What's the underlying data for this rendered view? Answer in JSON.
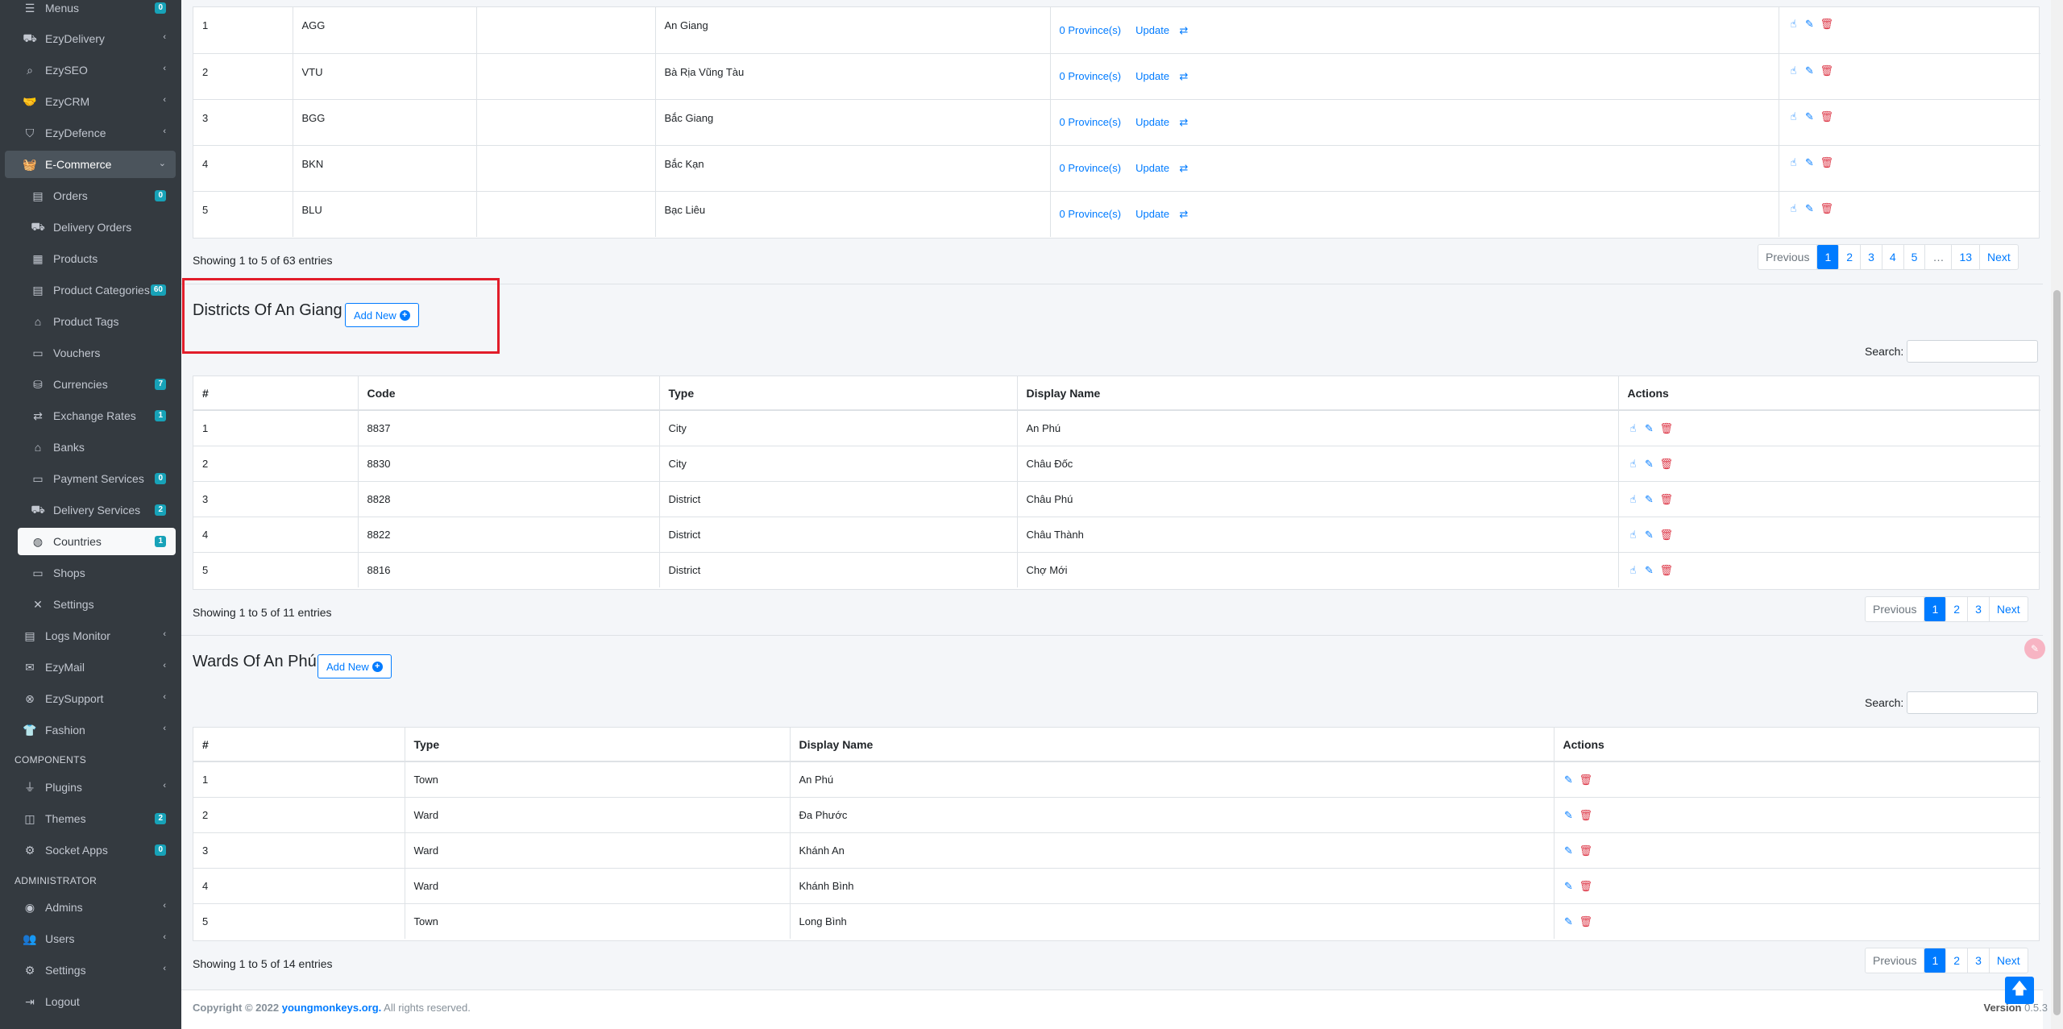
{
  "sidebar": {
    "items": [
      {
        "label": "Menus",
        "icon": "bars-icon",
        "glyph": "☰",
        "badge": "0"
      },
      {
        "label": "EzyDelivery",
        "icon": "truck-icon",
        "glyph": "⛟",
        "chevron": "‹"
      },
      {
        "label": "EzySEO",
        "icon": "search-icon",
        "glyph": "⌕",
        "chevron": "‹"
      },
      {
        "label": "EzyCRM",
        "icon": "handshake-icon",
        "glyph": "🤝",
        "chevron": "‹"
      },
      {
        "label": "EzyDefence",
        "icon": "shield-icon",
        "glyph": "⛉",
        "chevron": "‹"
      },
      {
        "label": "E-Commerce",
        "icon": "basket-icon",
        "glyph": "🧺",
        "chevron": "⌄"
      },
      {
        "label": "Orders",
        "icon": "file-icon",
        "glyph": "▤",
        "badge": "0",
        "child": true
      },
      {
        "label": "Delivery Orders",
        "icon": "dolly-icon",
        "glyph": "⛟",
        "child": true
      },
      {
        "label": "Products",
        "icon": "boxes-icon",
        "glyph": "▦",
        "child": true
      },
      {
        "label": "Product Categories",
        "icon": "file-alt-icon",
        "glyph": "▤",
        "badge": "60",
        "child": true
      },
      {
        "label": "Product Tags",
        "icon": "tags-icon",
        "glyph": "⌂",
        "child": true
      },
      {
        "label": "Vouchers",
        "icon": "ticket-icon",
        "glyph": "▭",
        "child": true
      },
      {
        "label": "Currencies",
        "icon": "coins-icon",
        "glyph": "⛁",
        "badge": "7",
        "child": true
      },
      {
        "label": "Exchange Rates",
        "icon": "exchange-icon",
        "glyph": "⇄",
        "badge": "1",
        "child": true
      },
      {
        "label": "Banks",
        "icon": "bank-icon",
        "glyph": "⌂",
        "child": true
      },
      {
        "label": "Payment Services",
        "icon": "credit-card-icon",
        "glyph": "▭",
        "badge": "0",
        "child": true
      },
      {
        "label": "Delivery Services",
        "icon": "shipping-icon",
        "glyph": "⛟",
        "badge": "2",
        "child": true
      },
      {
        "label": "Countries",
        "icon": "globe-icon",
        "glyph": "◍",
        "badge": "1",
        "child": true
      },
      {
        "label": "Shops",
        "icon": "store-icon",
        "glyph": "▭",
        "child": true
      },
      {
        "label": "Settings",
        "icon": "tools-icon",
        "glyph": "✕",
        "child": true
      },
      {
        "label": "Logs Monitor",
        "icon": "file-lines-icon",
        "glyph": "▤",
        "chevron": "‹"
      },
      {
        "label": "EzyMail",
        "icon": "envelope-icon",
        "glyph": "✉",
        "chevron": "‹"
      },
      {
        "label": "EzySupport",
        "icon": "support-icon",
        "glyph": "⊗",
        "chevron": "‹"
      },
      {
        "label": "Fashion",
        "icon": "tshirt-icon",
        "glyph": "👕",
        "chevron": "‹"
      },
      {
        "label": "Plugins",
        "icon": "plug-icon",
        "glyph": "⏚",
        "chevron": "‹"
      },
      {
        "label": "Themes",
        "icon": "layers-icon",
        "glyph": "◫",
        "badge": "2"
      },
      {
        "label": "Socket Apps",
        "icon": "socket-icon",
        "glyph": "⚙",
        "badge": "0"
      },
      {
        "label": "Admins",
        "icon": "user-circle-icon",
        "glyph": "◉",
        "chevron": "‹"
      },
      {
        "label": "Users",
        "icon": "users-icon",
        "glyph": "👥",
        "chevron": "‹"
      },
      {
        "label": "Settings",
        "icon": "cog-icon",
        "glyph": "⚙",
        "chevron": "‹"
      },
      {
        "label": "Logout",
        "icon": "logout-icon",
        "glyph": "⇥"
      }
    ],
    "headers": [
      "COMPONENTS",
      "ADMINISTRATOR"
    ]
  },
  "provinces": {
    "rows": [
      {
        "num": "1",
        "code": "AGG",
        "name": "An Giang",
        "count": "0 Province(s)",
        "update": "Update"
      },
      {
        "num": "2",
        "code": "VTU",
        "name": "Bà Rịa Vũng Tàu",
        "count": "0 Province(s)",
        "update": "Update"
      },
      {
        "num": "3",
        "code": "BGG",
        "name": "Bắc Giang",
        "count": "0 Province(s)",
        "update": "Update"
      },
      {
        "num": "4",
        "code": "BKN",
        "name": "Bắc Kạn",
        "count": "0 Province(s)",
        "update": "Update"
      },
      {
        "num": "5",
        "code": "BLU",
        "name": "Bạc Liêu",
        "count": "0 Province(s)",
        "update": "Update"
      }
    ],
    "showing": "Showing 1 to 5 of 63 entries",
    "pages": [
      "Previous",
      "1",
      "2",
      "3",
      "4",
      "5",
      "…",
      "13",
      "Next"
    ]
  },
  "districts": {
    "title": "Districts Of An Giang",
    "add_new": "Add New",
    "search_label": "Search:",
    "headers": [
      "#",
      "Code",
      "Type",
      "Display Name",
      "Actions"
    ],
    "rows": [
      {
        "num": "1",
        "code": "8837",
        "type": "City",
        "name": "An Phú"
      },
      {
        "num": "2",
        "code": "8830",
        "type": "City",
        "name": "Châu Đốc"
      },
      {
        "num": "3",
        "code": "8828",
        "type": "District",
        "name": "Châu Phú"
      },
      {
        "num": "4",
        "code": "8822",
        "type": "District",
        "name": "Châu Thành"
      },
      {
        "num": "5",
        "code": "8816",
        "type": "District",
        "name": "Chợ Mới"
      }
    ],
    "showing": "Showing 1 to 5 of 11 entries",
    "pages": [
      "Previous",
      "1",
      "2",
      "3",
      "Next"
    ]
  },
  "wards": {
    "title": "Wards Of An Phú",
    "add_new": "Add New",
    "search_label": "Search:",
    "headers": [
      "#",
      "Type",
      "Display Name",
      "Actions"
    ],
    "rows": [
      {
        "num": "1",
        "type": "Town",
        "name": "An Phú"
      },
      {
        "num": "2",
        "type": "Ward",
        "name": "Đa Phước"
      },
      {
        "num": "3",
        "type": "Ward",
        "name": "Khánh An"
      },
      {
        "num": "4",
        "type": "Ward",
        "name": "Khánh Bình"
      },
      {
        "num": "5",
        "type": "Town",
        "name": "Long Bình"
      }
    ],
    "showing": "Showing 1 to 5 of 14 entries",
    "pages": [
      "Previous",
      "1",
      "2",
      "3",
      "Next"
    ]
  },
  "footer": {
    "copyright": "Copyright © 2022",
    "org": "youngmonkeys.org.",
    "rights": "All rights reserved.",
    "version_label": "Version",
    "version": "0.5.3"
  },
  "colors": {
    "sidebar_bg": "#343a40",
    "accent": "#007bff",
    "danger": "#dc3545",
    "badge": "#17a2b8",
    "highlight": "#e11d2a"
  }
}
